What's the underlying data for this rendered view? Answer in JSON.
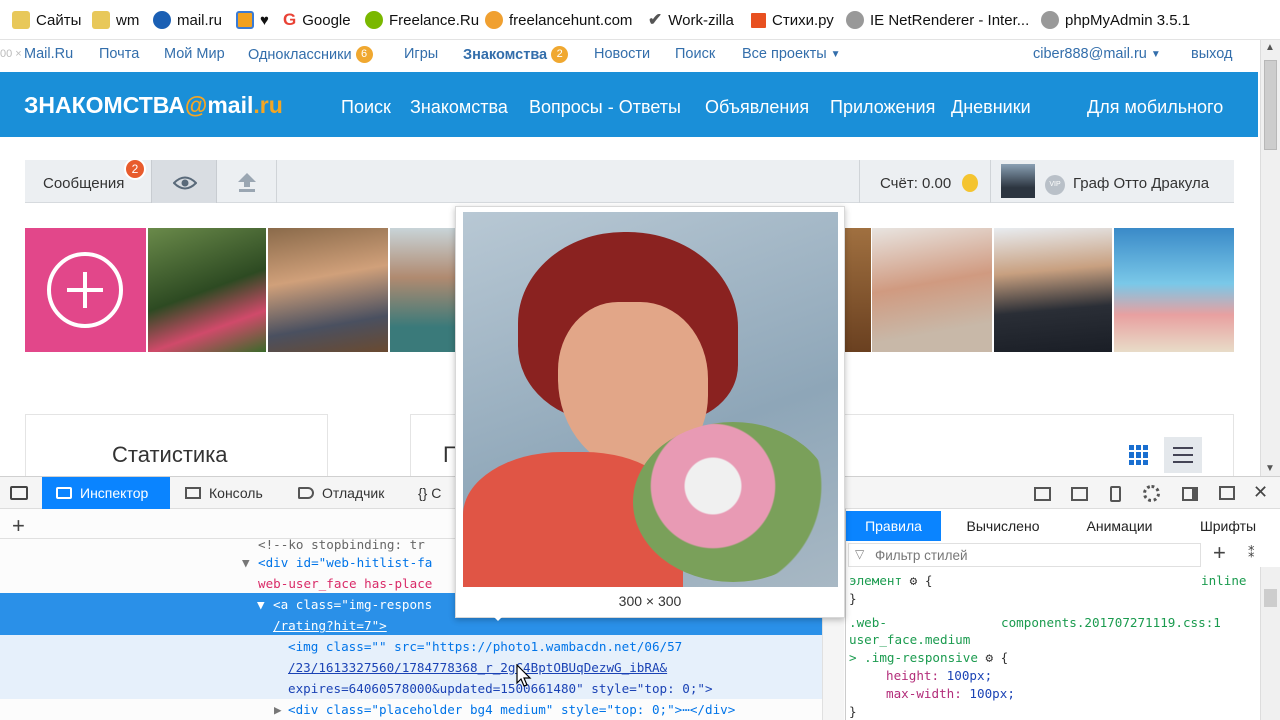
{
  "bookmarks": [
    {
      "label": "Сайты",
      "icon": "folder-icon",
      "color": "#e8c85a"
    },
    {
      "label": "wm",
      "icon": "folder-icon",
      "color": "#e8c85a"
    },
    {
      "label": "mail.ru",
      "icon": "mailru-icon",
      "color": "#1a5fb4"
    },
    {
      "label": "♥",
      "icon": "heart-icon",
      "color": "#3a7bd5"
    },
    {
      "label": "Google",
      "icon": "google-icon",
      "color": "#e94235"
    },
    {
      "label": "Freelance.Ru",
      "icon": "freelance-icon",
      "color": "#7ab800"
    },
    {
      "label": "freelancehunt.com",
      "icon": "freelancehunt-icon",
      "color": "#f0a030"
    },
    {
      "label": "Work-zilla",
      "icon": "workzilla-icon",
      "color": "#555555"
    },
    {
      "label": "Стихи.ру",
      "icon": "stihi-icon",
      "color": "#e85020"
    },
    {
      "label": "IE NetRenderer - Inter...",
      "icon": "globe-icon",
      "color": "#888888"
    },
    {
      "label": "phpMyAdmin 3.5.1",
      "icon": "globe-icon",
      "color": "#888888"
    }
  ],
  "topnav": {
    "items": [
      "Mail.Ru",
      "Почта",
      "Мой Мир",
      "Одноклассники",
      "Игры",
      "Знакомства",
      "Новости",
      "Поиск",
      "Все проекты"
    ],
    "ok_badge": "6",
    "znak_badge": "2",
    "user": "ciber888@mail.ru",
    "logout": "выход",
    "ghost": "00 ×"
  },
  "header": {
    "logo_main": "ЗНАКОМСТВА",
    "logo_at": "@",
    "logo_tail": "mail",
    "logo_ru": ".ru",
    "nav": [
      "Поиск",
      "Знакомства",
      "Вопросы - Ответы",
      "Объявления",
      "Приложения",
      "Дневники"
    ],
    "mobile": "Для мобильного"
  },
  "toolbar": {
    "messages": "Сообщения",
    "messages_badge": "2",
    "balance": "Счёт: 0.00",
    "vip": "VIP",
    "profile_name": "Граф Отто Дракула"
  },
  "stats": {
    "title": "Статистика",
    "second_title_partial": "П"
  },
  "tooltip": {
    "size": "300 × 300"
  },
  "devtools": {
    "tabs": [
      "Инспектор",
      "Консоль",
      "Отладчик",
      "{} С"
    ],
    "right_tabs": [
      "Правила",
      "Вычислено",
      "Анимации",
      "Шрифты"
    ],
    "filter_placeholder": "Фильтр стилей",
    "code": [
      {
        "t": "<!--ko stopbinding: tr"
      },
      {
        "t": "<div id=\"web-hitlist-fa"
      },
      {
        "t": "web-user_face has-place"
      },
      {
        "t": "<a class=\"img-respons"
      },
      {
        "t": "/rating?hit=7\">"
      },
      {
        "t": "<img class=\"\" src=\"https://photo1.wambacdn.net/06/57"
      },
      {
        "t": "/23/1613327560/1784778368_r_2gC4BptOBUqDezwG_ibRA&"
      },
      {
        "t": "expires=64060578000&updated=1500661480\" style=\"top: 0;\">"
      },
      {
        "t": "<div class=\"placeholder bg4 medium\" style=\"top: 0;\">⋯</div>"
      }
    ],
    "rules": {
      "element": "элемент",
      "inline": "inline",
      "selector1": ".web-",
      "selector2": "user_face.medium",
      "source": "components.201707271119.css:1",
      "selector3": "> .img-responsive",
      "prop1": "height:",
      "val1": "100px;",
      "prop2": "max-width:",
      "val2": "100px;"
    }
  }
}
